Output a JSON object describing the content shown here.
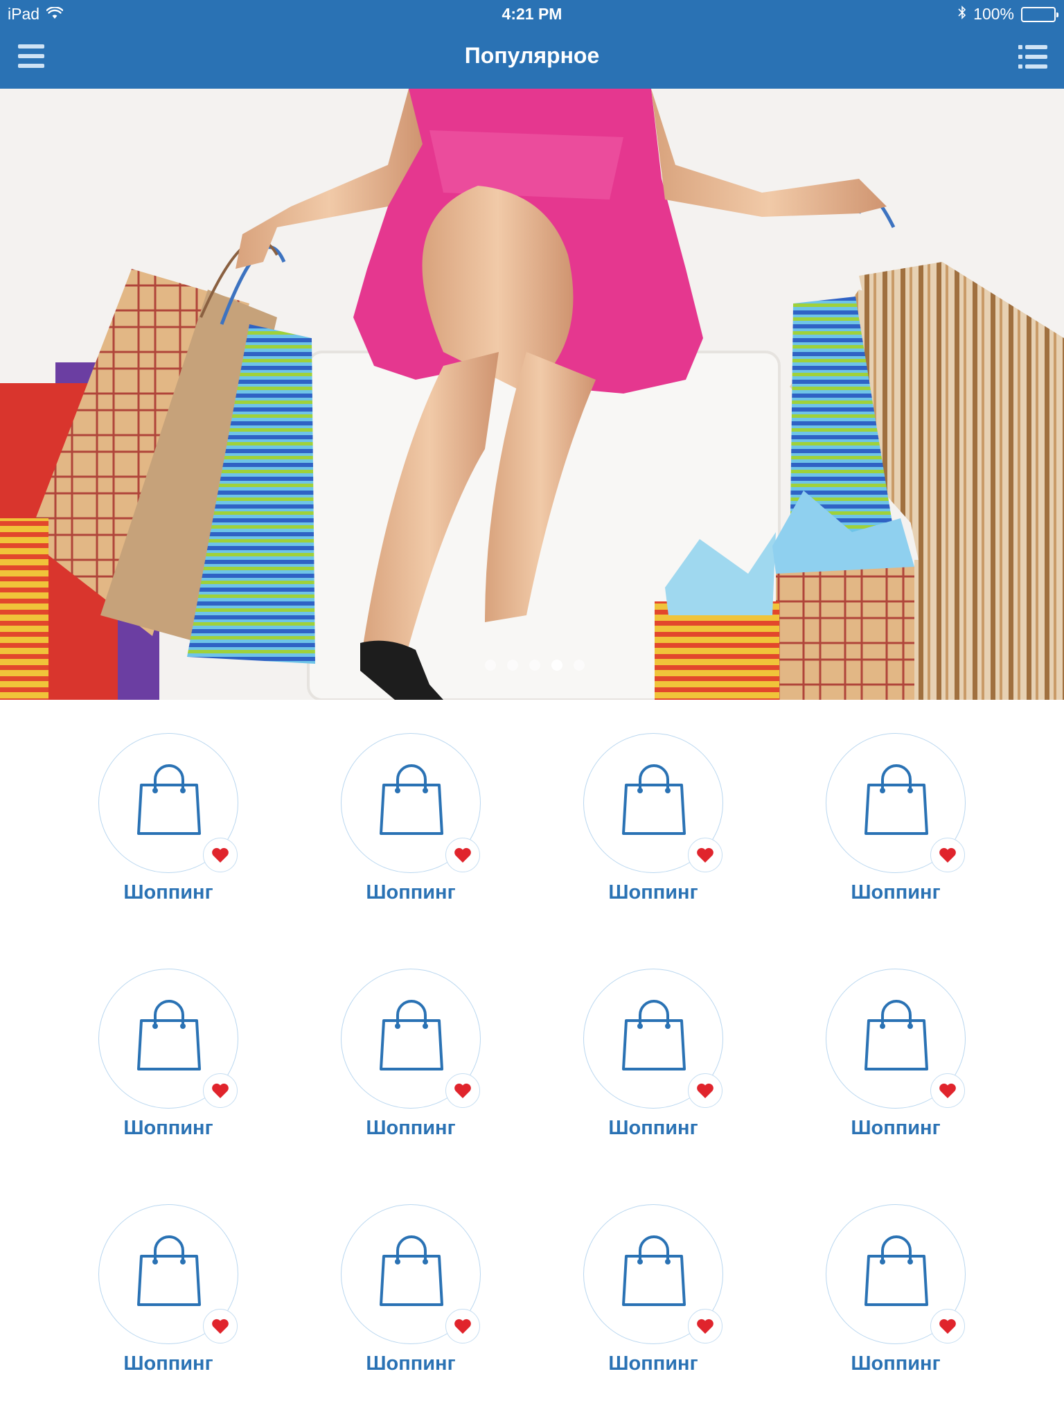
{
  "status_bar": {
    "device": "iPad",
    "time": "4:21 PM",
    "battery": "100%"
  },
  "nav": {
    "title": "Популярное",
    "left_icon": "hamburger-menu-icon",
    "right_icon": "list-icon"
  },
  "banner": {
    "slide_count": 5,
    "active_slide": 4
  },
  "colors": {
    "brand": "#2a72b4",
    "accent_heart": "#e0242c",
    "circle_border": "#b8d6ef"
  },
  "tiles": [
    {
      "label": "Шоппинг",
      "icon": "shopping-bag-icon",
      "favorite": true
    },
    {
      "label": "Шоппинг",
      "icon": "shopping-bag-icon",
      "favorite": true
    },
    {
      "label": "Шоппинг",
      "icon": "shopping-bag-icon",
      "favorite": true
    },
    {
      "label": "Шоппинг",
      "icon": "shopping-bag-icon",
      "favorite": true
    },
    {
      "label": "Шоппинг",
      "icon": "shopping-bag-icon",
      "favorite": true
    },
    {
      "label": "Шоппинг",
      "icon": "shopping-bag-icon",
      "favorite": true
    },
    {
      "label": "Шоппинг",
      "icon": "shopping-bag-icon",
      "favorite": true
    },
    {
      "label": "Шоппинг",
      "icon": "shopping-bag-icon",
      "favorite": true
    },
    {
      "label": "Шоппинг",
      "icon": "shopping-bag-icon",
      "favorite": true
    },
    {
      "label": "Шоппинг",
      "icon": "shopping-bag-icon",
      "favorite": true
    },
    {
      "label": "Шоппинг",
      "icon": "shopping-bag-icon",
      "favorite": true
    },
    {
      "label": "Шоппинг",
      "icon": "shopping-bag-icon",
      "favorite": true
    }
  ]
}
